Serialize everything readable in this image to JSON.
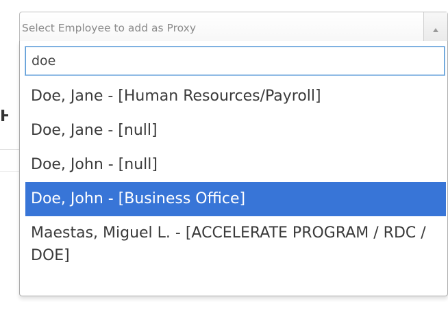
{
  "select": {
    "placeholder": "Select Employee to add as Proxy"
  },
  "search": {
    "value": "doe"
  },
  "results": [
    {
      "label": "Doe, Jane - [Human Resources/Payroll]",
      "highlighted": false
    },
    {
      "label": "Doe, Jane - [null]",
      "highlighted": false
    },
    {
      "label": "Doe, John - [null]",
      "highlighted": false
    },
    {
      "label": "Doe, John - [Business Office]",
      "highlighted": true
    },
    {
      "label": "Maestas, Miguel L. - [ACCELERATE PROGRAM / RDC / DOE]",
      "highlighted": false
    }
  ],
  "colors": {
    "highlight": "#3875d7",
    "input_focus_border": "#5b9bd5"
  },
  "icons": {
    "select_arrow": "chevron-up-icon"
  }
}
